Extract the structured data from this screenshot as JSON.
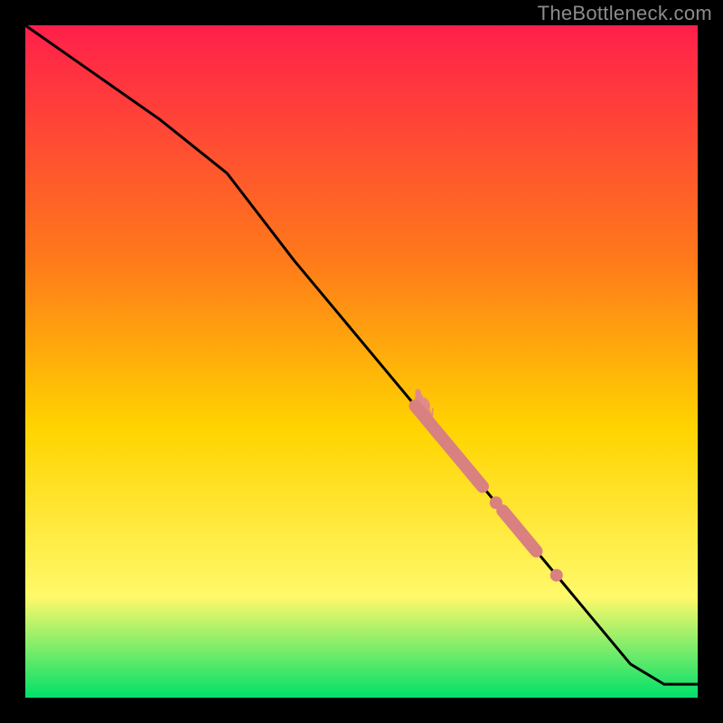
{
  "watermark": "TheBottleneck.com",
  "colors": {
    "gradient_top": "#ff1f4b",
    "gradient_mid1": "#ff7a1a",
    "gradient_mid2": "#ffd400",
    "gradient_mid3": "#fff96a",
    "gradient_bottom": "#00e06a",
    "line": "#000000",
    "marker": "#d98080",
    "marker_fuzz": "#e08a8a"
  },
  "chart_data": {
    "type": "line",
    "title": "",
    "xlabel": "",
    "ylabel": "",
    "xlim": [
      0,
      100
    ],
    "ylim": [
      0,
      100
    ],
    "grid": false,
    "legend": false,
    "series": [
      {
        "name": "curve",
        "x": [
          0,
          10,
          20,
          30,
          40,
          50,
          60,
          70,
          80,
          90,
          95,
          100
        ],
        "y": [
          100,
          93,
          86,
          78,
          65,
          53,
          41,
          29,
          17,
          5,
          2,
          2
        ]
      }
    ],
    "markers": [
      {
        "name": "cluster-a",
        "style": "thick-segment",
        "x_range": [
          58,
          68
        ],
        "y_range": [
          43,
          31
        ]
      },
      {
        "name": "dot-1",
        "style": "dot",
        "x": 70,
        "y": 29
      },
      {
        "name": "cluster-b",
        "style": "thick-segment",
        "x_range": [
          71,
          76
        ],
        "y_range": [
          28,
          22
        ]
      },
      {
        "name": "dot-2",
        "style": "dot",
        "x": 79,
        "y": 18
      }
    ]
  }
}
